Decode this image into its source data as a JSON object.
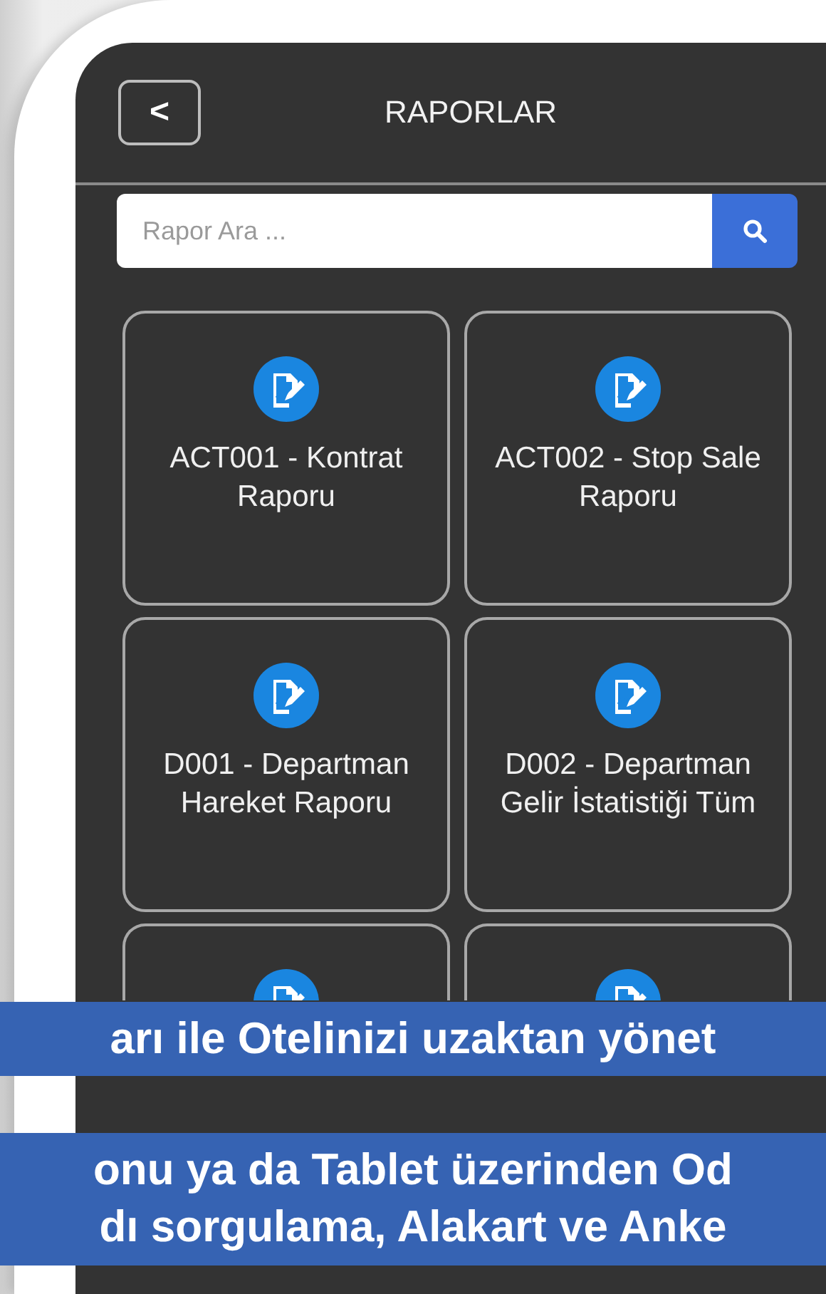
{
  "header": {
    "back_button": "<",
    "title": "RAPORLAR"
  },
  "search": {
    "placeholder": "Rapor Ara ..."
  },
  "reports": [
    {
      "kind": "report",
      "label": "ACT001 - Kontrat Raporu"
    },
    {
      "kind": "report",
      "label": "ACT002 - Stop Sale Raporu"
    },
    {
      "kind": "report",
      "label": "D001 - Departman Hareket Raporu"
    },
    {
      "kind": "report",
      "label": "D002 - Departman Gelir İstatistiği Tüm"
    },
    {
      "kind": "covered"
    },
    {
      "kind": "covered"
    }
  ],
  "banners": [
    {
      "lines": [
        "arı ile Otelinizi uzaktan yönet"
      ]
    },
    {
      "lines": [
        "onu ya da Tablet üzerinden Od",
        "dı sorgulama, Alakart ve Anke"
      ]
    }
  ]
}
